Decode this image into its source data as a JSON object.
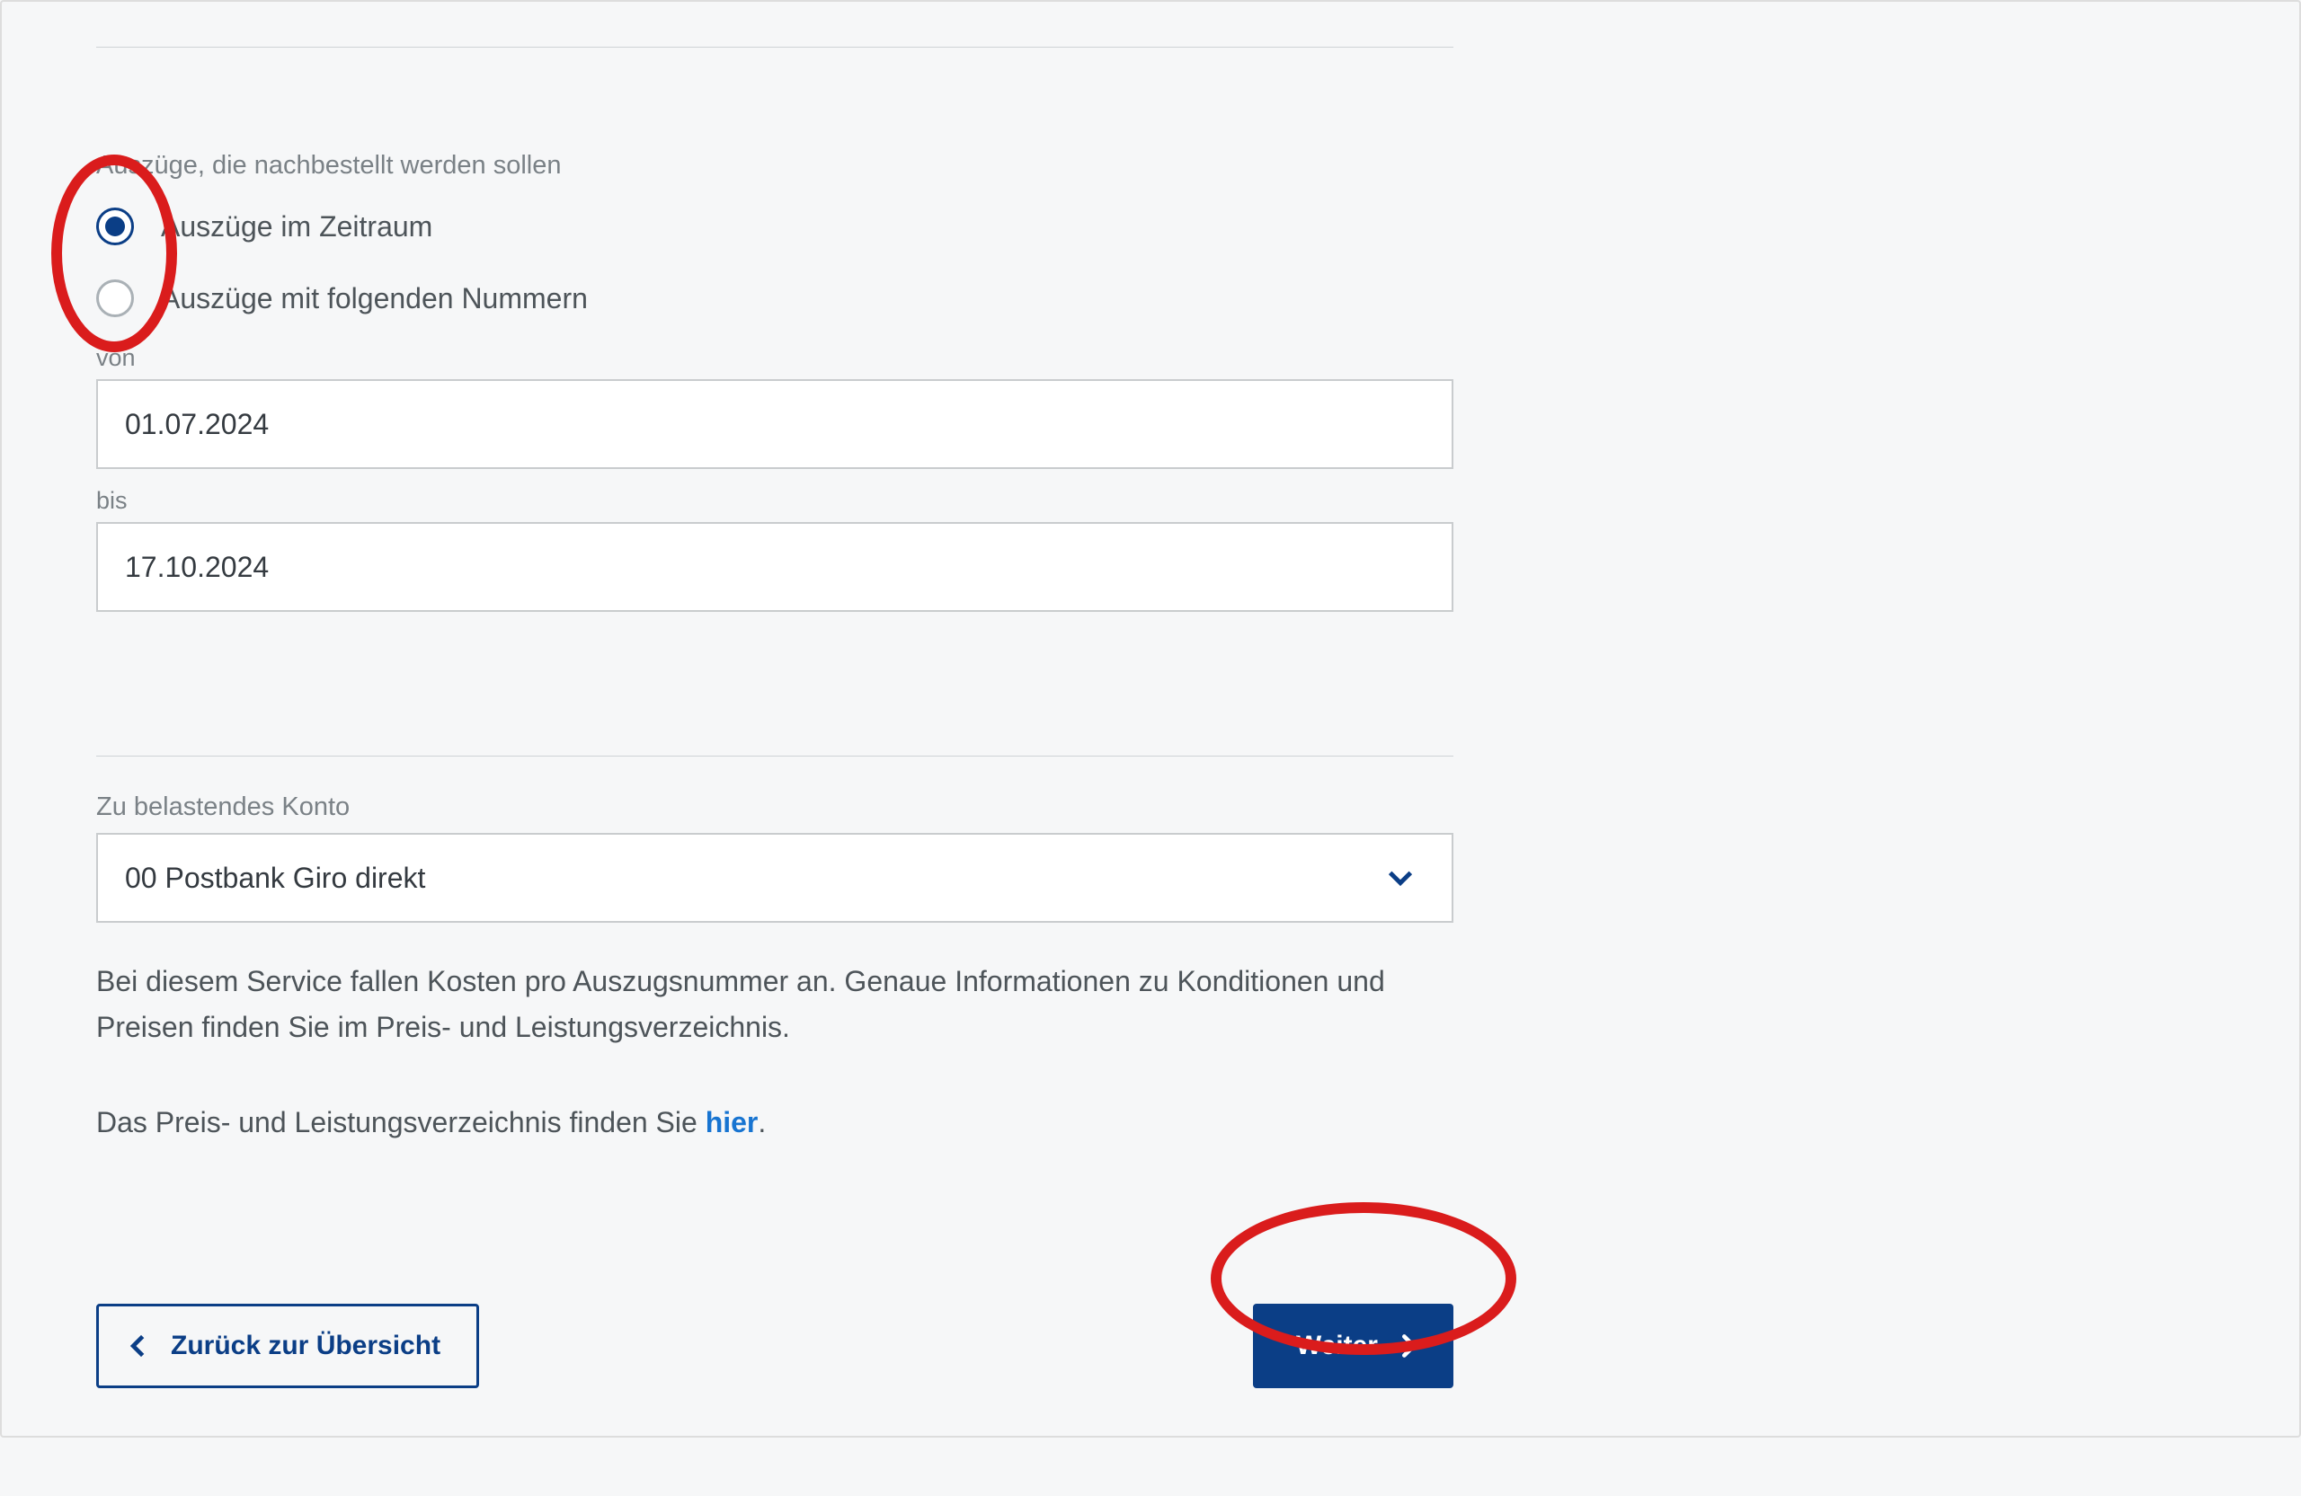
{
  "section1": {
    "group_label": "Auszüge, die nachbestellt werden sollen",
    "radio1_label": "Auszüge im Zeitraum",
    "radio2_label": "Auszüge mit folgenden Nummern",
    "radio_selected": "zeitraum"
  },
  "fields": {
    "von_label": "von",
    "von_value": "01.07.2024",
    "bis_label": "bis",
    "bis_value": "17.10.2024"
  },
  "account": {
    "label": "Zu belastendes Konto",
    "selected": "00 Postbank Giro direkt"
  },
  "info": {
    "text": "Bei diesem Service fallen Kosten pro Auszugsnummer an. Genaue Informationen zu Konditionen und Preisen finden Sie im Preis- und Leistungsverzeichnis.",
    "link_prefix": "Das Preis- und Leistungsverzeichnis finden Sie ",
    "link_label": "hier",
    "link_suffix": "."
  },
  "buttons": {
    "back": "Zurück zur Übersicht",
    "next": "Weiter"
  }
}
